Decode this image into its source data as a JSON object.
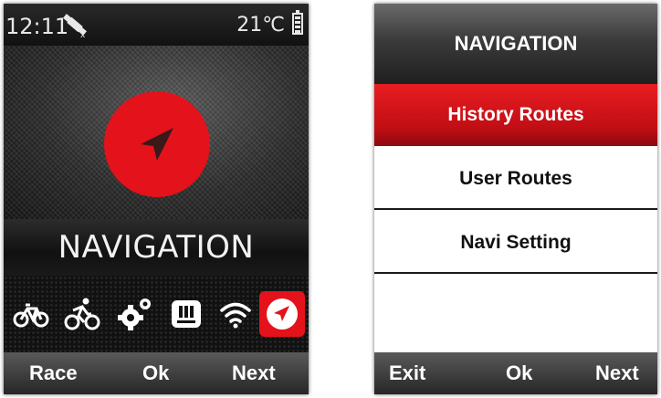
{
  "left_screen": {
    "status": {
      "time": "12:11",
      "satellite_icon": "satellite-icon",
      "temperature": "21℃",
      "battery_icon": "battery-icon"
    },
    "hero_icon": "navigation-arrow-icon",
    "title": "NAVIGATION",
    "mode_icons": [
      "bicycle-icon",
      "cyclist-icon",
      "gears-icon",
      "sensor-icon",
      "wifi-icon",
      "navigation-icon"
    ],
    "softkeys": {
      "left": "Race",
      "center": "Ok",
      "right": "Next"
    }
  },
  "right_screen": {
    "header": "NAVIGATION",
    "menu": [
      {
        "label": "History Routes",
        "selected": true
      },
      {
        "label": "User Routes",
        "selected": false
      },
      {
        "label": "Navi Setting",
        "selected": false
      }
    ],
    "softkeys": {
      "left": "Exit",
      "center": "Ok",
      "right": "Next"
    }
  },
  "colors": {
    "accent": "#e4121a",
    "background": "#1b1b1b",
    "text": "#ffffff"
  }
}
